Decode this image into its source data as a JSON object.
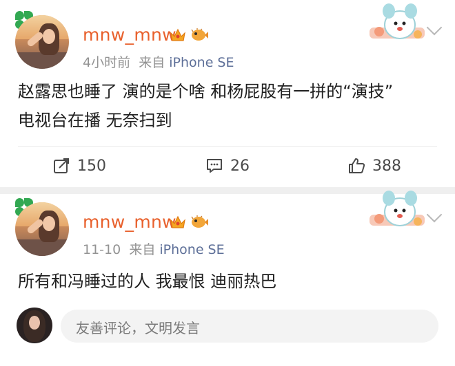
{
  "posts": [
    {
      "username": "mnw_mnw",
      "time": "4小时前",
      "source_prefix": "来自",
      "source": "iPhone SE",
      "body_line1": "赵露思也睡了 演的是个啥 和杨屁股有一拼的“演技”",
      "body_line2": "电视台在播 无奈扫到",
      "reposts": "150",
      "comments": "26",
      "likes": "388"
    },
    {
      "username": "mnw_mnw",
      "time": "11-10",
      "source_prefix": "来自",
      "source": "iPhone SE",
      "body_line1": "所有和冯睡过的人 我最恨 迪丽热巴"
    }
  ],
  "comment_input": {
    "placeholder": "友善评论，文明发言"
  },
  "colors": {
    "username": "#e8602c",
    "source_link": "#5d6f98",
    "meta": "#939393"
  },
  "icons": [
    "clover-icon",
    "crown-badge-icon",
    "pufferfish-badge-icon",
    "mascot-sticker-icon",
    "chevron-down-icon",
    "repost-icon",
    "comment-icon",
    "like-icon"
  ]
}
